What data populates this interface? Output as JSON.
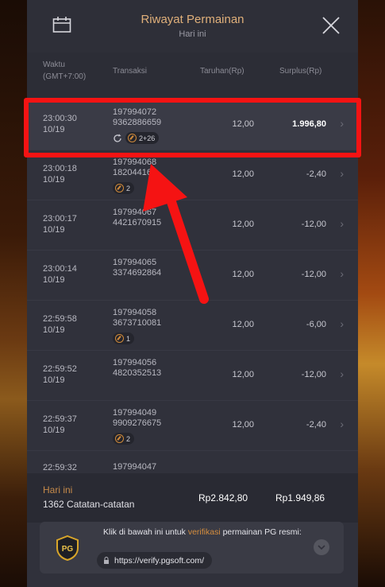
{
  "header": {
    "title": "Riwayat Permainan",
    "subtitle": "Hari ini"
  },
  "columns": {
    "time": "Waktu\n(GMT+7:00)",
    "transaction": "Transaksi",
    "bet": "Taruhan(Rp)",
    "surplus": "Surplus(Rp)"
  },
  "rows": [
    {
      "time": "23:00:30",
      "date": "10/19",
      "id1": "197994072",
      "id2": "9362886659",
      "bet": "12,00",
      "surplus": "1.996,80",
      "badge": "2+26",
      "spin": true
    },
    {
      "time": "23:00:18",
      "date": "10/19",
      "id1": "197994068",
      "id2": "182044168",
      "bet": "12,00",
      "surplus": "-2,40",
      "badge": "2",
      "spin": false
    },
    {
      "time": "23:00:17",
      "date": "10/19",
      "id1": "197994067",
      "id2": "4421670915",
      "bet": "12,00",
      "surplus": "-12,00"
    },
    {
      "time": "23:00:14",
      "date": "10/19",
      "id1": "197994065",
      "id2": "3374692864",
      "bet": "12,00",
      "surplus": "-12,00"
    },
    {
      "time": "22:59:58",
      "date": "10/19",
      "id1": "197994058",
      "id2": "3673710081",
      "bet": "12,00",
      "surplus": "-6,00",
      "badge": "1",
      "spin": false
    },
    {
      "time": "22:59:52",
      "date": "10/19",
      "id1": "197994056",
      "id2": "4820352513",
      "bet": "12,00",
      "surplus": "-12,00"
    },
    {
      "time": "22:59:37",
      "date": "10/19",
      "id1": "197994049",
      "id2": "9909276675",
      "bet": "12,00",
      "surplus": "-2,40",
      "badge": "2",
      "spin": false
    },
    {
      "time": "22:59:32",
      "date": "",
      "id1": "197994047",
      "id2": "",
      "bet": "",
      "surplus": ""
    }
  ],
  "summary": {
    "label": "Hari ini",
    "count": "1362 Catatan-catatan",
    "total_bet": "Rp2.842,80",
    "total_surplus": "Rp1.949,86"
  },
  "verify": {
    "text_before": "Klik di bawah ini untuk ",
    "link": "verifikasi",
    "text_after": " permainan PG resmi:",
    "url": "https://verify.pgsoft.com/",
    "logo": "PG"
  },
  "colors": {
    "accent": "#e0b07a",
    "highlight": "#f51313",
    "panel": "#30313b"
  }
}
